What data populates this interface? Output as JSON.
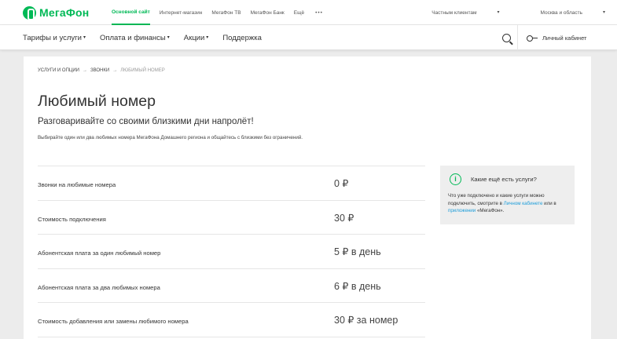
{
  "brand": {
    "name": "МегаФон",
    "color": "#00b956"
  },
  "topbar": {
    "links": [
      "Основной сайт",
      "Интернет-магазин",
      "МегаФон ТВ",
      "МегаФон Банк"
    ],
    "more": "Ещё",
    "more_dots": "•••",
    "client_type": "Частным клиентам",
    "region": "Москва и область"
  },
  "mainnav": {
    "items": [
      "Тарифы и услуги",
      "Оплата и финансы",
      "Акции",
      "Поддержка"
    ],
    "cabinet": "Личный кабинет"
  },
  "breadcrumb": [
    "Услуги и опции",
    "Звонки",
    "Любимый номер"
  ],
  "page": {
    "title": "Любимый номер",
    "subtitle": "Разговаривайте со своими близкими дни напролёт!",
    "description": "Выбирайте один или два любимых номера МегаФона Домашнего региона и общайтесь с близкими без ограничений."
  },
  "prices": [
    {
      "label": "Звонки на любимые номера",
      "value": "0 ₽"
    },
    {
      "label": "Стоимость подключения",
      "value": "30 ₽"
    },
    {
      "label": "Абонентская плата за один любимый номер",
      "value": "5 ₽ в день"
    },
    {
      "label": "Абонентская плата за два любимых номера",
      "value": "6 ₽ в день"
    },
    {
      "label": "Стоимость добавления или замены любимого номера",
      "value": "30 ₽ за номер"
    }
  ],
  "info": {
    "title": "Какие ещё есть услуги?",
    "text_1": "Что уже подключено и какие услуги можно подключить, смотрите в",
    "link_1": "Личном кабинете",
    "text_2": "или в",
    "link_2": "приложении",
    "text_3": "«МегаФон»."
  }
}
